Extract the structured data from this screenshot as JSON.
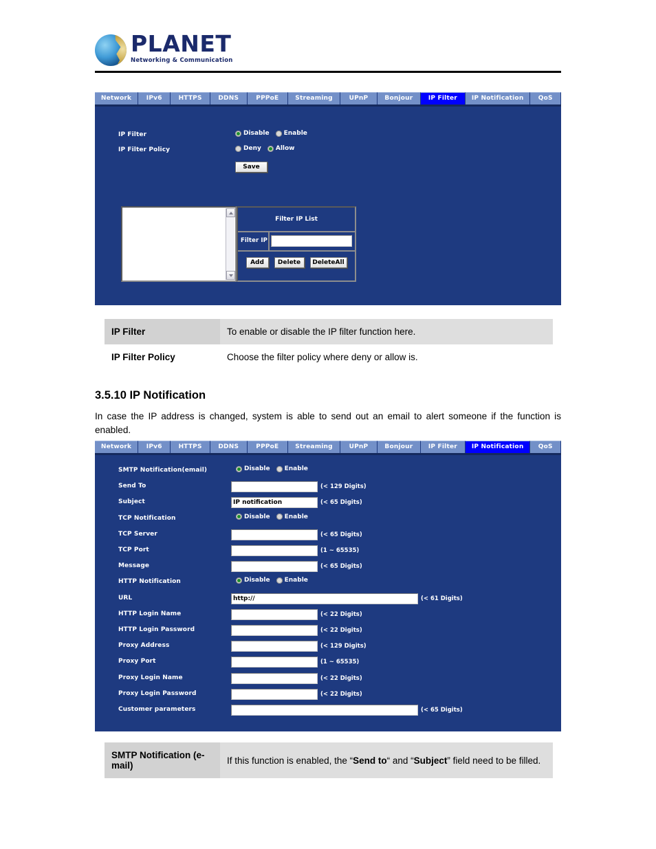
{
  "brand": {
    "name": "PLANET",
    "tagline": "Networking & Communication"
  },
  "nav": {
    "tabs": [
      "Network",
      "IPv6",
      "HTTPS",
      "DDNS",
      "PPPoE",
      "Streaming",
      "UPnP",
      "Bonjour",
      "IP Filter",
      "IP Notification",
      "QoS"
    ],
    "active_first_panel": "IP Filter",
    "active_second_panel": "IP Notification",
    "active_color": "#0000ff",
    "inactive_color": "#7390c8",
    "panel_color": "#1e3a80"
  },
  "ip_filter_panel": {
    "fields": {
      "ip_filter_label": "IP Filter",
      "ip_filter_options": [
        "Disable",
        "Enable"
      ],
      "ip_filter_selected": "Disable",
      "ip_filter_policy_label": "IP Filter Policy",
      "ip_filter_policy_options": [
        "Deny",
        "Allow"
      ],
      "ip_filter_policy_selected": "Allow"
    },
    "save_button": "Save",
    "filter_list": {
      "title": "Filter IP List",
      "filter_ip_label": "Filter IP",
      "filter_ip_value": "",
      "filter_ip_placeholder": "",
      "list_items": [],
      "buttons": [
        "Add",
        "Delete",
        "DeleteAll"
      ]
    }
  },
  "ip_filter_desc": {
    "rows": [
      {
        "key": "IP Filter",
        "value": "To enable or disable the IP filter function here."
      },
      {
        "key": "IP Filter Policy",
        "value": "Choose the filter policy where deny or allow is."
      }
    ]
  },
  "section": {
    "heading": "3.5.10 IP Notification",
    "paragraph": "In case the IP address is changed, system is able to send out an email to alert someone if the function is enabled."
  },
  "ip_notification_panel": {
    "rows": [
      {
        "label": "SMTP Notification(email)",
        "type": "radio",
        "options": [
          "Disable",
          "Enable"
        ],
        "selected": "Disable"
      },
      {
        "label": "Send To",
        "type": "text",
        "value": "",
        "hint": "(< 129 Digits)",
        "width": "normal"
      },
      {
        "label": "Subject",
        "type": "text",
        "value": "IP notification",
        "hint": "(< 65 Digits)",
        "width": "normal"
      },
      {
        "label": "TCP Notification",
        "type": "radio",
        "options": [
          "Disable",
          "Enable"
        ],
        "selected": "Disable"
      },
      {
        "label": "TCP Server",
        "type": "text",
        "value": "",
        "hint": "(< 65 Digits)",
        "width": "normal"
      },
      {
        "label": "TCP Port",
        "type": "text",
        "value": "",
        "hint": "(1 ~ 65535)",
        "width": "normal"
      },
      {
        "label": "Message",
        "type": "text",
        "value": "",
        "hint": "(< 65 Digits)",
        "width": "normal"
      },
      {
        "label": "HTTP Notification",
        "type": "radio",
        "options": [
          "Disable",
          "Enable"
        ],
        "selected": "Disable"
      },
      {
        "label": "URL",
        "type": "text",
        "value": "http://",
        "hint": "(< 61 Digits)",
        "width": "wide"
      },
      {
        "label": "HTTP Login Name",
        "type": "text",
        "value": "",
        "hint": "(< 22 Digits)",
        "width": "normal"
      },
      {
        "label": "HTTP Login Password",
        "type": "text",
        "value": "",
        "hint": "(< 22 Digits)",
        "width": "normal"
      },
      {
        "label": "Proxy Address",
        "type": "text",
        "value": "",
        "hint": "(< 129 Digits)",
        "width": "normal"
      },
      {
        "label": "Proxy Port",
        "type": "text",
        "value": "",
        "hint": "(1 ~ 65535)",
        "width": "normal"
      },
      {
        "label": "Proxy Login Name",
        "type": "text",
        "value": "",
        "hint": "(< 22 Digits)",
        "width": "normal"
      },
      {
        "label": "Proxy Login Password",
        "type": "text",
        "value": "",
        "hint": "(< 22 Digits)",
        "width": "normal"
      },
      {
        "label": "Customer parameters",
        "type": "text",
        "value": "",
        "hint": "(< 65 Digits)",
        "width": "wide"
      }
    ]
  },
  "ip_notification_desc": {
    "key": "SMTP Notification (e-mail)",
    "value_parts": [
      {
        "text": "If this function is enabled, the “",
        "bold": false
      },
      {
        "text": "Send to",
        "bold": true
      },
      {
        "text": "“ and “",
        "bold": false
      },
      {
        "text": "Subject",
        "bold": true
      },
      {
        "text": "” field need to be filled.",
        "bold": false
      }
    ]
  }
}
